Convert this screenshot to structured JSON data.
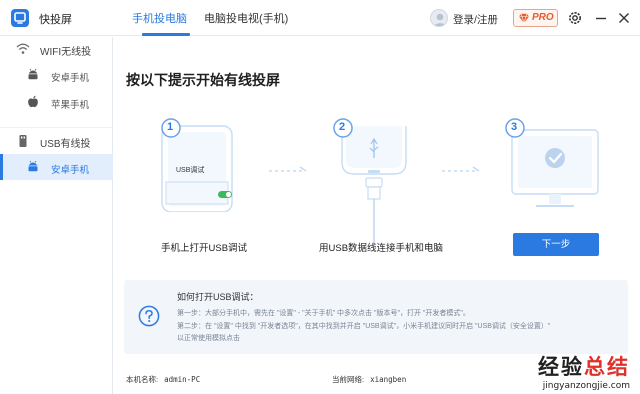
{
  "app": {
    "name": "快投屏"
  },
  "tabs": [
    {
      "label": "手机投电脑",
      "active": true
    },
    {
      "label": "电脑投电视(手机)",
      "active": false
    }
  ],
  "header": {
    "login_label": "登录/注册",
    "pro_label": "PRO"
  },
  "sidebar": {
    "sections": [
      {
        "label": "WIFI无线投",
        "icon": "wifi-icon",
        "items": [
          {
            "label": "安卓手机",
            "icon": "android-icon"
          },
          {
            "label": "苹果手机",
            "icon": "apple-icon"
          }
        ]
      },
      {
        "label": "USB有线投",
        "icon": "usb-icon",
        "items": [
          {
            "label": "安卓手机",
            "icon": "android-icon",
            "active": true
          }
        ]
      }
    ]
  },
  "main": {
    "title": "按以下提示开始有线投屏",
    "steps": [
      {
        "number": "1",
        "label": "手机上打开USB调试",
        "toggle_label": "USB调试"
      },
      {
        "number": "2",
        "label": "用USB数据线连接手机和电脑"
      },
      {
        "number": "3",
        "label": ""
      }
    ],
    "next_button": "下一步",
    "help": {
      "title": "如何打开USB调试：",
      "lines": [
        "第一步：大部分手机中，需先在 \"设置\" - \"关于手机\" 中多次点击 \"版本号\"，打开 \"开发者模式\"。",
        "第二步：在 \"设置\" 中找到 \"开发者选项\"，在其中找到并开启 \"USB调试\"，小米手机建议同时开启 \"USB调试（安全设置）\"",
        "以正常使用模拟点击"
      ]
    }
  },
  "footer": {
    "pc_name_label": "本机名称:",
    "pc_name_value": "admin-PC",
    "network_label": "当前网络:",
    "network_value": "xiangben"
  },
  "watermark": {
    "part1": "经验",
    "part2": "总结",
    "url": "jingyanzongjie.com"
  },
  "colors": {
    "accent": "#2a7ae2",
    "pro": "#e85a2a"
  }
}
